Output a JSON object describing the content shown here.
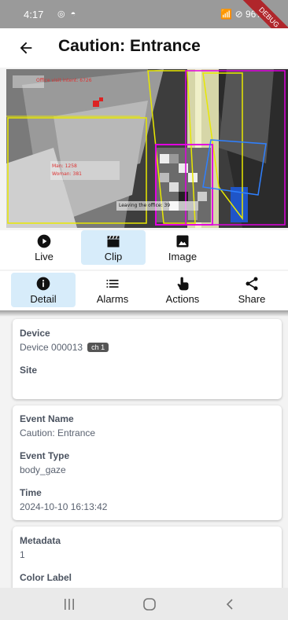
{
  "status_bar": {
    "time": "4:17",
    "left_icons": "◎ ◓",
    "right_text": "📶 ⊘ 96%",
    "debug_banner": "DEBUG"
  },
  "app_bar": {
    "title": "Caution: Entrance"
  },
  "video": {
    "overlay_top": "Office visit intent: 6726",
    "overlay_counts_man": "Man: 1258",
    "overlay_counts_woman": "Woman: 381",
    "overlay_leaving": "Leaving the office: 39"
  },
  "tabs_row1": [
    {
      "label": "Live",
      "icon": "play-circle-icon",
      "active": false
    },
    {
      "label": "Clip",
      "icon": "clapperboard-icon",
      "active": true
    },
    {
      "label": "Image",
      "icon": "image-icon",
      "active": false
    }
  ],
  "tabs_row2": [
    {
      "label": "Detail",
      "icon": "info-icon",
      "active": true
    },
    {
      "label": "Alarms",
      "icon": "list-icon",
      "active": false
    },
    {
      "label": "Actions",
      "icon": "hand-pointer-icon",
      "active": false
    },
    {
      "label": "Share",
      "icon": "share-icon",
      "active": false
    }
  ],
  "device_card": {
    "device_label": "Device",
    "device_value": "Device 000013",
    "channel_chip": "ch 1",
    "site_label": "Site",
    "site_value": ""
  },
  "event_card": {
    "event_name_label": "Event Name",
    "event_name_value": "Caution: Entrance",
    "event_type_label": "Event Type",
    "event_type_value": "body_gaze",
    "time_label": "Time",
    "time_value": "2024-10-10 16:13:42"
  },
  "meta_card": {
    "metadata_label": "Metadata",
    "metadata_value": "1",
    "color_label_label": "Color Label"
  },
  "colors": {
    "active_tab_bg": "#d7ecfa",
    "chip_bg": "#555555",
    "detection_yellow": "#e8e800",
    "detection_magenta": "#e000e0",
    "detection_blue": "#2f80ff"
  }
}
